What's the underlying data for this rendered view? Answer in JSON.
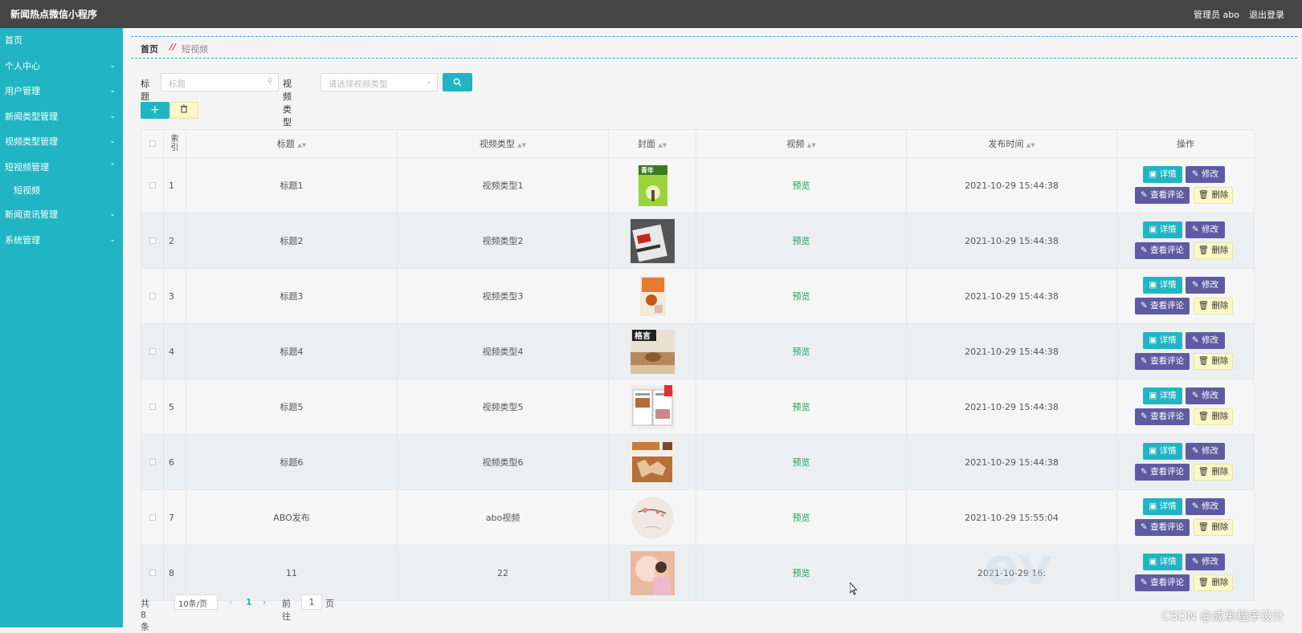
{
  "topbar": {
    "title": "新闻热点微信小程序",
    "user": "管理员 abo",
    "logout": "退出登录"
  },
  "sidebar": {
    "items": [
      {
        "label": "首页",
        "chevron": ""
      },
      {
        "label": "个人中心",
        "chevron": "⌄"
      },
      {
        "label": "用户管理",
        "chevron": "⌄"
      },
      {
        "label": "新闻类型管理",
        "chevron": "⌄"
      },
      {
        "label": "视频类型管理",
        "chevron": "⌄"
      },
      {
        "label": "短视频管理",
        "chevron": "⌃"
      }
    ],
    "sub_item": "短视频",
    "items_after": [
      {
        "label": "新闻资讯管理",
        "chevron": "⌄"
      },
      {
        "label": "系统管理",
        "chevron": "⌄"
      }
    ]
  },
  "breadcrumb": {
    "home": "首页",
    "sep": "//",
    "current": "短视频"
  },
  "search": {
    "title_label": "标题",
    "title_placeholder": "标题",
    "type_label": "视频类型",
    "type_placeholder": "请选择视频类型"
  },
  "toolbar": {
    "add_label": "+",
    "delete_icon": "trash-icon"
  },
  "table": {
    "headers": {
      "index": "索引",
      "title": "标题",
      "type": "视频类型",
      "cover": "封面",
      "video": "视频",
      "time": "发布时间",
      "actions": "操作"
    },
    "action_labels": {
      "detail": "详情",
      "edit": "修改",
      "comment": "查看评论",
      "remove": "删除"
    },
    "rows": [
      {
        "idx": "1",
        "title": "标题1",
        "type": "视频类型1",
        "video": "预览",
        "time": "2021-10-29 15:44:38",
        "cover": "book-cover-green"
      },
      {
        "idx": "2",
        "title": "标题2",
        "type": "视频类型2",
        "video": "预览",
        "time": "2021-10-29 15:44:38",
        "cover": "book-cover-dark"
      },
      {
        "idx": "3",
        "title": "标题3",
        "type": "视频类型3",
        "video": "预览",
        "time": "2021-10-29 15:44:38",
        "cover": "book-cover-orange"
      },
      {
        "idx": "4",
        "title": "标题4",
        "type": "视频类型4",
        "video": "预览",
        "time": "2021-10-29 15:44:38",
        "cover": "book-cover-brown"
      },
      {
        "idx": "5",
        "title": "标题5",
        "type": "视频类型5",
        "video": "预览",
        "time": "2021-10-29 15:44:38",
        "cover": "book-cover-open"
      },
      {
        "idx": "6",
        "title": "标题6",
        "type": "视频类型6",
        "video": "预览",
        "time": "2021-10-29 15:44:38",
        "cover": "book-cover-map"
      },
      {
        "idx": "7",
        "title": "ABO发布",
        "type": "abo视频",
        "video": "预览",
        "time": "2021-10-29 15:55:04",
        "cover": "round-painting"
      },
      {
        "idx": "8",
        "title": "11",
        "type": "22",
        "video": "预览",
        "time": "2021-10-29 16:",
        "cover": "photo-girl"
      }
    ]
  },
  "pager": {
    "total": "共 8 条",
    "size": "10条/页",
    "page": "1",
    "goto": "前往",
    "goto_value": "1",
    "page_unit": "页"
  },
  "overlay": {
    "watermark": "ev",
    "csdn": "CSDN @成承程序设计"
  },
  "colors": {
    "accent": "#21b5c3",
    "purple": "#5f5ba3",
    "topbar": "#454545",
    "danger_bg": "#fbf8c8"
  }
}
